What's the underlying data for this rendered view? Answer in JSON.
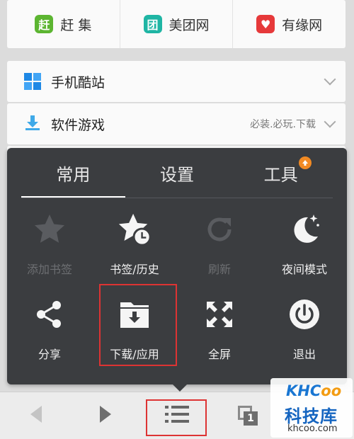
{
  "quick_links": [
    {
      "badge": "赶",
      "label": "赶 集",
      "color": "#5cb531",
      "icon": "ganji-icon"
    },
    {
      "badge": "团",
      "label": "美团网",
      "color": "#1fb5a4",
      "icon": "meituan-icon"
    },
    {
      "badge": "♥",
      "label": "有缘网",
      "color": "#e6393a",
      "icon": "youyuan-icon"
    }
  ],
  "nav": {
    "apps_label": "手机酷站",
    "games_label": "软件游戏",
    "games_sub": "必装.必玩.下载"
  },
  "menu": {
    "tabs": [
      {
        "label": "常用",
        "active": true
      },
      {
        "label": "设置",
        "active": false
      },
      {
        "label": "工具",
        "active": false
      }
    ],
    "items": [
      {
        "label": "添加书签",
        "icon": "star-add-icon",
        "disabled": true
      },
      {
        "label": "书签/历史",
        "icon": "star-clock-icon",
        "disabled": false
      },
      {
        "label": "刷新",
        "icon": "refresh-icon",
        "disabled": true
      },
      {
        "label": "夜间模式",
        "icon": "moon-icon",
        "disabled": false
      },
      {
        "label": "分享",
        "icon": "share-icon",
        "disabled": false
      },
      {
        "label": "下载/应用",
        "icon": "download-folder-icon",
        "disabled": false
      },
      {
        "label": "全屏",
        "icon": "fullscreen-icon",
        "disabled": false
      },
      {
        "label": "退出",
        "icon": "power-icon",
        "disabled": false
      }
    ]
  },
  "bottom_bar": {
    "tab_count": "1"
  },
  "watermark": {
    "logo_a": "KHC",
    "logo_b": "oo",
    "cn": "科技库",
    "url": "khcoo.com"
  }
}
